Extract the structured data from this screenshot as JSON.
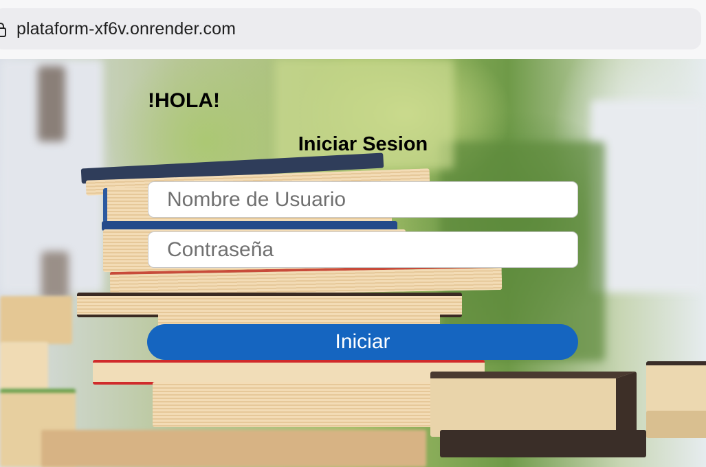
{
  "browser": {
    "url": "plataform-xf6v.onrender.com"
  },
  "login": {
    "greeting": "!HOLA!",
    "title": "Iniciar Sesion",
    "username_placeholder": "Nombre de Usuario",
    "password_placeholder": "Contraseña",
    "submit_label": "Iniciar"
  },
  "colors": {
    "button": "#1565c0",
    "button_text": "#ffffff",
    "field_background": "#ffffff"
  },
  "icons": {
    "address_bar": "lock-icon"
  }
}
